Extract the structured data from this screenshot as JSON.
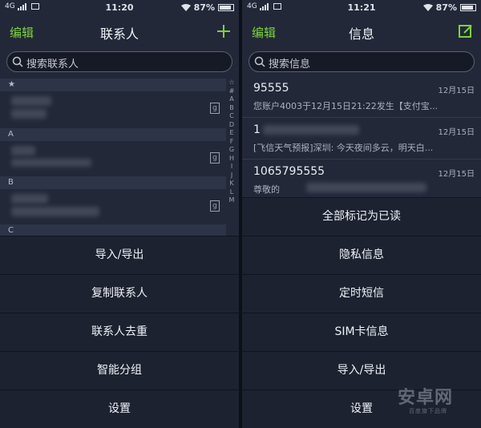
{
  "left": {
    "status": {
      "network": "4G",
      "time": "11:20",
      "battery": "87%"
    },
    "nav": {
      "edit": "编辑",
      "title": "联系人",
      "action_icon": "plus-icon"
    },
    "search": {
      "placeholder": "搜索联系人"
    },
    "sections": [
      "★",
      "A",
      "B",
      "C"
    ],
    "alphabet": [
      "☆",
      "#",
      "A",
      "B",
      "C",
      "D",
      "E",
      "F",
      "G",
      "H",
      "I",
      "J",
      "K",
      "L",
      "M"
    ],
    "contact_icon": "g",
    "menu": [
      "导入/导出",
      "复制联系人",
      "联系人去重",
      "智能分组",
      "设置"
    ]
  },
  "right": {
    "status": {
      "network": "4G",
      "time": "11:21",
      "battery": "87%"
    },
    "nav": {
      "edit": "编辑",
      "title": "信息",
      "action_icon": "compose-icon"
    },
    "search": {
      "placeholder": "搜索信息"
    },
    "messages": [
      {
        "sender": "95555",
        "date": "12月15日",
        "preview": "您账户4003于12月15日21:22发生【支付宝..."
      },
      {
        "sender": "1",
        "date": "12月15日",
        "preview": "[飞信天气预报]深圳: 今天夜间多云，明天白..."
      },
      {
        "sender": "1065795555",
        "date": "12月15日",
        "preview": "尊敬的"
      }
    ],
    "menu": [
      "全部标记为已读",
      "隐私信息",
      "定时短信",
      "SIM卡信息",
      "导入/导出",
      "设置"
    ]
  },
  "watermark": {
    "title": "安卓网",
    "subtitle": "百度旗下品牌"
  },
  "colors": {
    "accent": "#7dd23c",
    "background": "#222838",
    "sheet": "#1d2231"
  }
}
